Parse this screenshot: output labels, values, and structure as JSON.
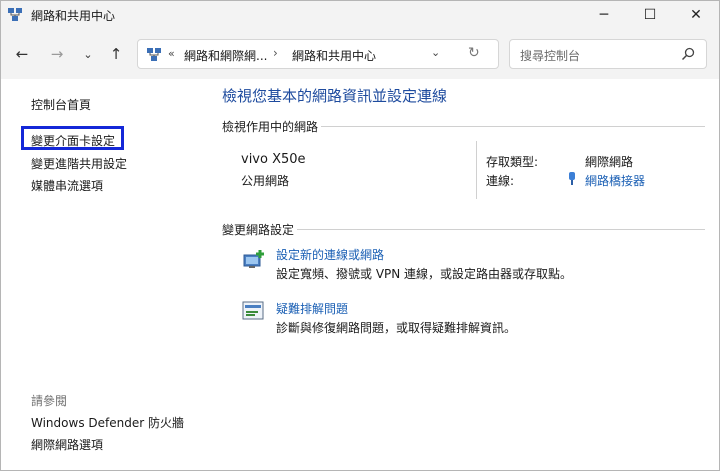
{
  "window": {
    "title": "網路和共用中心",
    "controls": {
      "minimize": "─",
      "maximize": "☐",
      "close": "✕"
    }
  },
  "nav": {
    "back": "←",
    "forward": "→",
    "history": "⌄",
    "up": "↑",
    "address": {
      "chevron": "«",
      "crumbs": [
        "網路和網際網...",
        "網路和共用中心"
      ],
      "separator": "›",
      "dropdown": "⌄",
      "refresh": "↻"
    },
    "search": {
      "placeholder": "搜尋控制台"
    }
  },
  "sidebar": {
    "home": "控制台首頁",
    "links": [
      "變更介面卡設定",
      "變更進階共用設定",
      "媒體串流選項"
    ],
    "see_also_heading": "請參閱",
    "see_also": [
      "Windows Defender 防火牆",
      "網際網路選項"
    ]
  },
  "main": {
    "title": "檢視您基本的網路資訊並設定連線",
    "active_networks_heading": "檢視作用中的網路",
    "network": {
      "name": "vivo X50e",
      "category": "公用網路",
      "access_type_label": "存取類型:",
      "access_type_value": "網際網路",
      "connections_label": "連線:",
      "connections_value": "網路橋接器"
    },
    "change_settings_heading": "變更網路設定",
    "tasks": [
      {
        "link": "設定新的連線或網路",
        "desc": "設定寬頻、撥號或 VPN 連線，或設定路由器或存取點。",
        "icon": "new-connection-icon"
      },
      {
        "link": "疑難排解問題",
        "desc": "診斷與修復網路問題，或取得疑難排解資訊。",
        "icon": "troubleshoot-icon"
      }
    ]
  },
  "colors": {
    "title_blue": "#1e4b9e",
    "link_blue": "#1a5fb4",
    "highlight_box": "#1428d8",
    "chrome": "#f3f3f3"
  }
}
